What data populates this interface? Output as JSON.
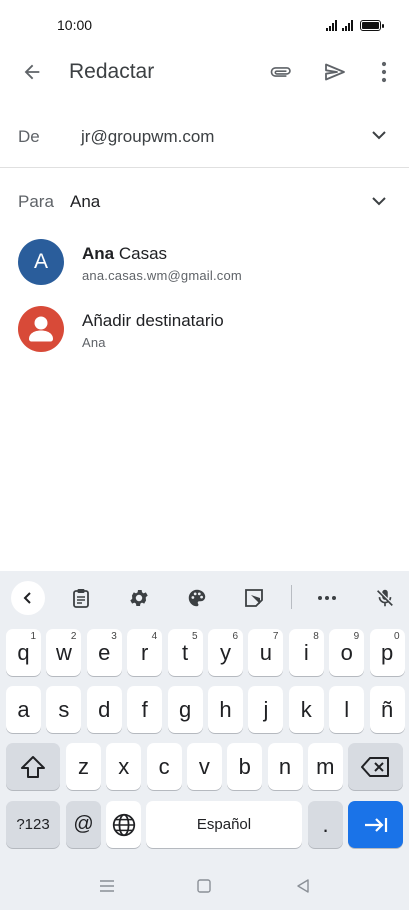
{
  "status_bar": {
    "time": "10:00",
    "icons": [
      "signal-icon",
      "signal-icon",
      "battery-icon"
    ]
  },
  "app_bar": {
    "title": "Redactar",
    "icons": {
      "back": "arrow-left-icon",
      "attach": "paperclip-icon",
      "send": "send-icon",
      "more": "more-vert-icon"
    }
  },
  "compose": {
    "from_label": "De",
    "from_value": "jr@groupwm.com",
    "to_label": "Para",
    "to_value": "Ana"
  },
  "suggestions": [
    {
      "avatar_letter": "A",
      "name_bold": "Ana",
      "name_rest": " Casas",
      "subtitle": "ana.casas.wm@gmail.com",
      "avatar_color": "#2a5d9b"
    },
    {
      "name": "Añadir destinatario",
      "subtitle": "Ana",
      "avatar_color": "#d84a38",
      "avatar_icon": "person-icon"
    }
  ],
  "keyboard": {
    "toolbar_icons": [
      "chevron-left-icon",
      "clipboard-icon",
      "gear-icon",
      "palette-icon",
      "sticker-icon",
      "more-horiz-icon",
      "mic-off-icon"
    ],
    "row1": [
      {
        "k": "q",
        "h": "1"
      },
      {
        "k": "w",
        "h": "2"
      },
      {
        "k": "e",
        "h": "3"
      },
      {
        "k": "r",
        "h": "4"
      },
      {
        "k": "t",
        "h": "5"
      },
      {
        "k": "y",
        "h": "6"
      },
      {
        "k": "u",
        "h": "7"
      },
      {
        "k": "i",
        "h": "8"
      },
      {
        "k": "o",
        "h": "9"
      },
      {
        "k": "p",
        "h": "0"
      }
    ],
    "row2": [
      "a",
      "s",
      "d",
      "f",
      "g",
      "h",
      "j",
      "k",
      "l",
      "ñ"
    ],
    "row3": [
      "z",
      "x",
      "c",
      "v",
      "b",
      "n",
      "m"
    ],
    "symbols_key": "?123",
    "at_key": "@",
    "space_label": "Español",
    "period_key": ".",
    "action_color": "#1a73e8"
  },
  "nav_bar": {
    "icons": [
      "recents-icon",
      "home-icon",
      "back-triangle-icon"
    ]
  }
}
